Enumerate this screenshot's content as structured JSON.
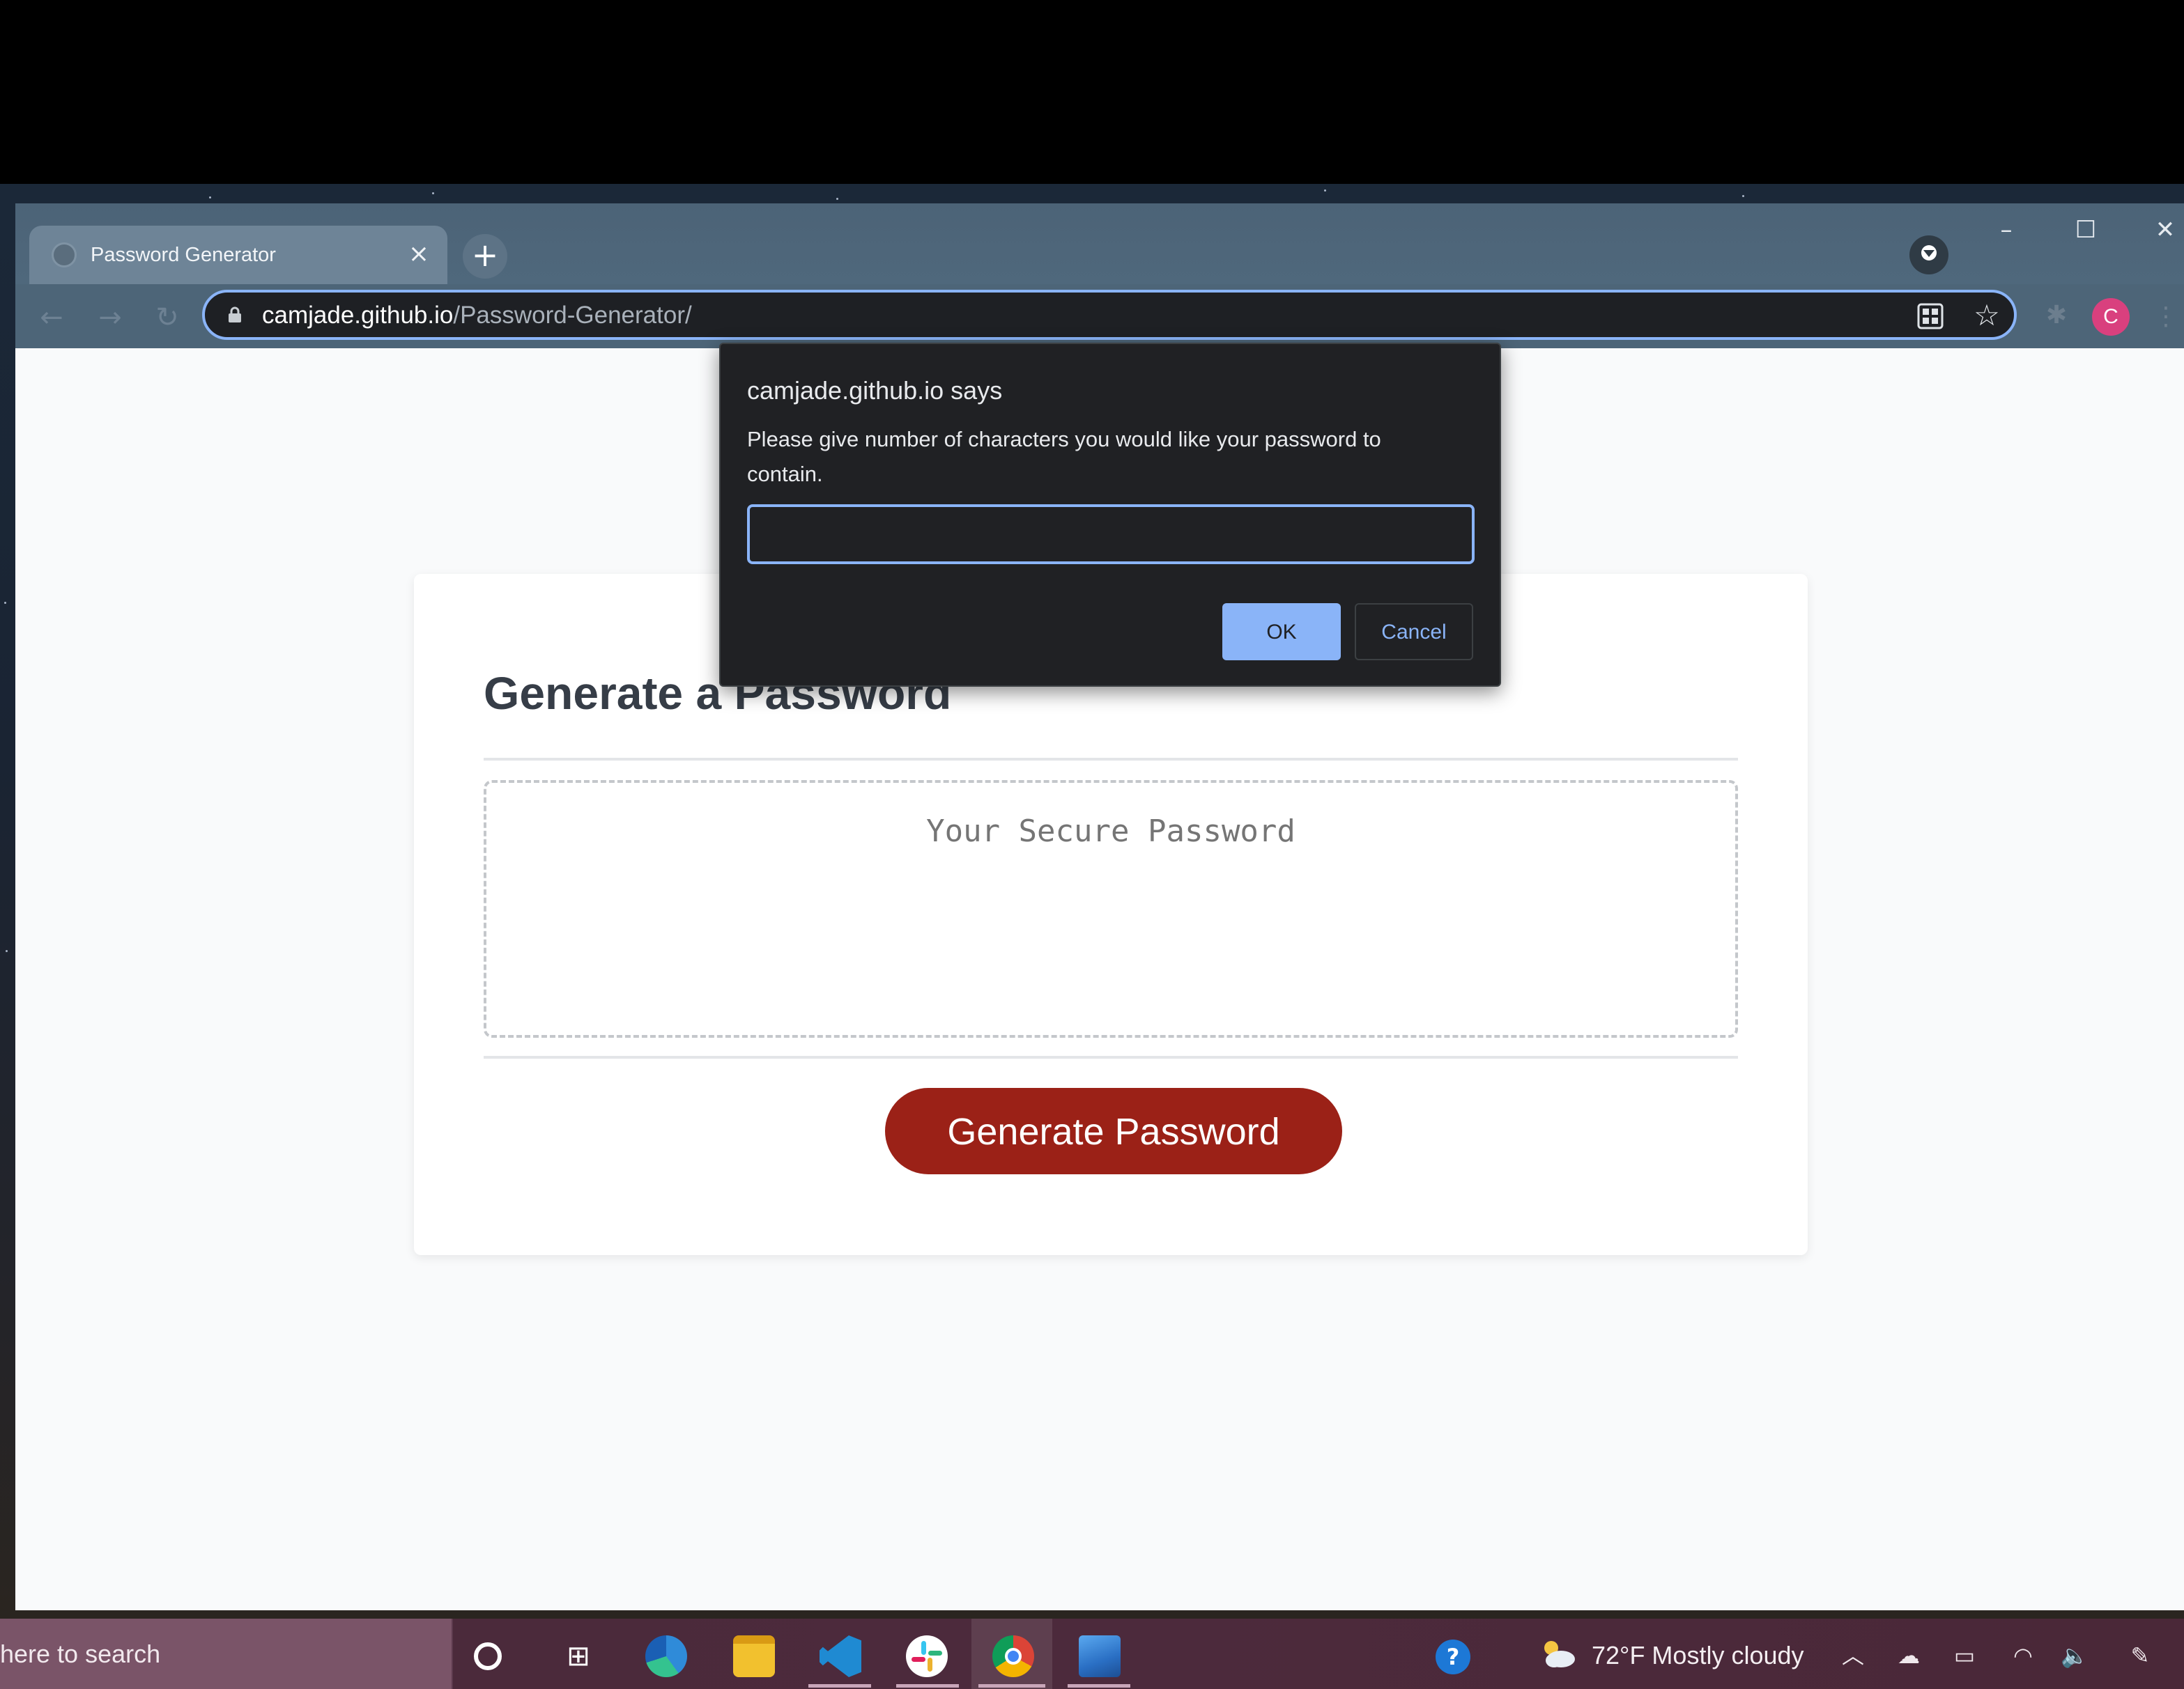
{
  "browser": {
    "tab_title": "Password Generator",
    "tab_close": "×",
    "new_tab": "+",
    "url_host": "camjade.github.io",
    "url_path": "/Password-Generator/",
    "minimize": "–",
    "maximize": "☐",
    "close": "✕",
    "back": "←",
    "forward": "→",
    "reload": "↻",
    "star": "☆",
    "extensions": "✱",
    "menu": "⋮",
    "avatar_letter": "C",
    "icons": [
      "globe-icon",
      "lock-icon",
      "qr-code-icon",
      "star-icon",
      "puzzle-icon",
      "tab-search-icon"
    ]
  },
  "page": {
    "title": "Generate a Password",
    "password_placeholder": "Your Secure Password",
    "generate_button": "Generate Password",
    "accent_color": "#9b2117"
  },
  "dialog": {
    "title": "camjade.github.io says",
    "message": "Please give number of characters you would like your password to contain.",
    "input_value": "",
    "ok_label": "OK",
    "cancel_label": "Cancel",
    "accent_color": "#8ab4f8"
  },
  "taskbar": {
    "search_text": "here to search",
    "taskview": "⊞",
    "help": "?",
    "weather_text": "72°F  Mostly cloudy",
    "chevron": "︿",
    "onedrive": "☁",
    "battery": "▭",
    "wifi": "◠",
    "volume": "🔈",
    "pen": "✎",
    "apps": [
      "cortana-icon",
      "task-view-icon",
      "edge-icon",
      "file-explorer-icon",
      "vscode-icon",
      "slack-icon",
      "chrome-icon",
      "photos-icon"
    ]
  }
}
